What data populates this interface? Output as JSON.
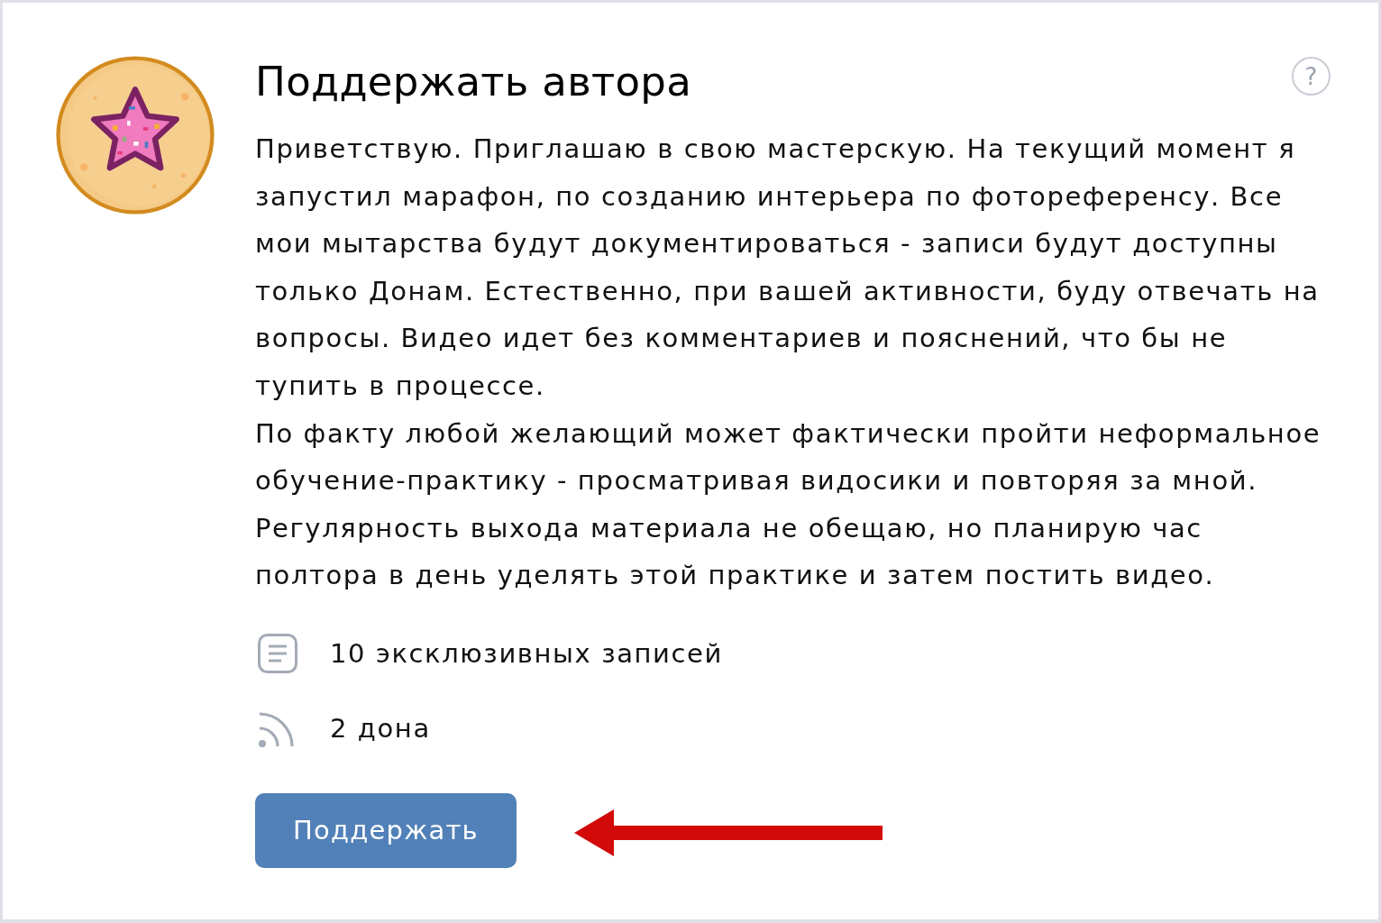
{
  "title": "Поддержать автора",
  "help_button": {
    "glyph": "?"
  },
  "description": [
    "Приветствую. Приглашаю в свою мастерскую. На текущий момент я запустил марафон, по созданию интерьера по фотореференсу. Все мои мытарства будут документироваться - записи будут доступны только Донам. Естественно, при вашей активности, буду отвечать на вопросы. Видео идет без комментариев и пояснений, что бы не тупить в процессе.",
    "По факту любой желающий может фактически пройти неформальное обучение-практику - просматривая видосики и повторяя за мной.",
    "Регулярность выхода материала не обещаю, но планирую час полтора в день уделять этой практике и затем постить видео."
  ],
  "stats": [
    {
      "kind": "posts",
      "text": "10 эксклюзивных записей"
    },
    {
      "kind": "donors",
      "text": "2 дона"
    }
  ],
  "button": {
    "label": "Поддержать"
  }
}
